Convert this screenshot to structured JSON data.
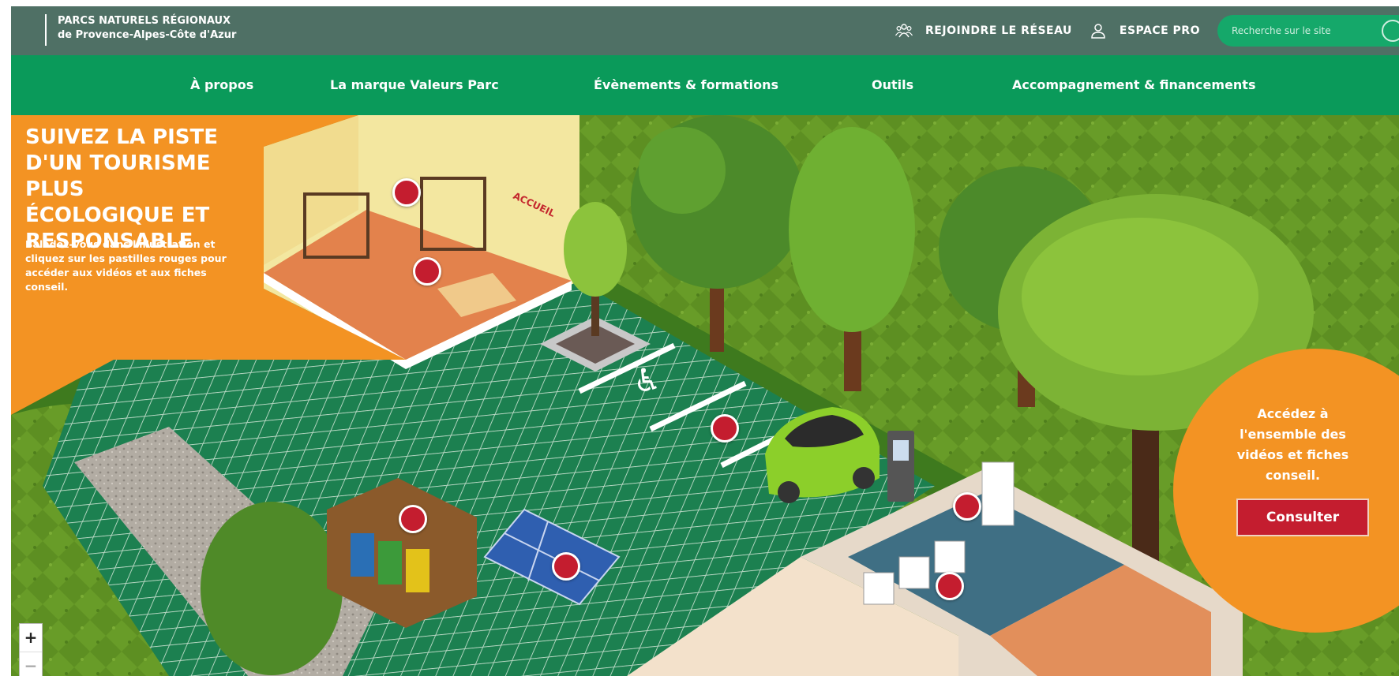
{
  "header": {
    "logo_line1": "PARCS NATURELS RÉGIONAUX",
    "logo_line2": "de Provence-Alpes-Côte d'Azur",
    "join_label": "REJOINDRE LE RÉSEAU",
    "pro_label": "ESPACE PRO",
    "search_placeholder": "Recherche sur le site"
  },
  "nav": {
    "items": [
      "À propos",
      "La marque Valeurs Parc",
      "Évènements & formations",
      "Outils",
      "Accompagnement & financements"
    ]
  },
  "intro": {
    "title": "SUIVEZ LA PISTE D'UN TOURISME PLUS ÉCOLOGIQUE ET RESPONSABLE",
    "text": "Baladez-vous dans l'illustration et cliquez sur les pastilles rouges pour accéder aux vidéos et aux fiches conseil."
  },
  "scene": {
    "accueil_sign": "ACCUEIL"
  },
  "cta": {
    "text": "Accédez à l'ensemble des vidéos et fiches conseil.",
    "button": "Consulter"
  },
  "zoom": {
    "plus": "+",
    "minus": "−"
  },
  "colors": {
    "topbar": "#4f7065",
    "nav": "#0a9a5a",
    "orange": "#f39323",
    "red": "#c41d2f",
    "grass": "#5a8c22",
    "tile": "#1f8a5a"
  }
}
